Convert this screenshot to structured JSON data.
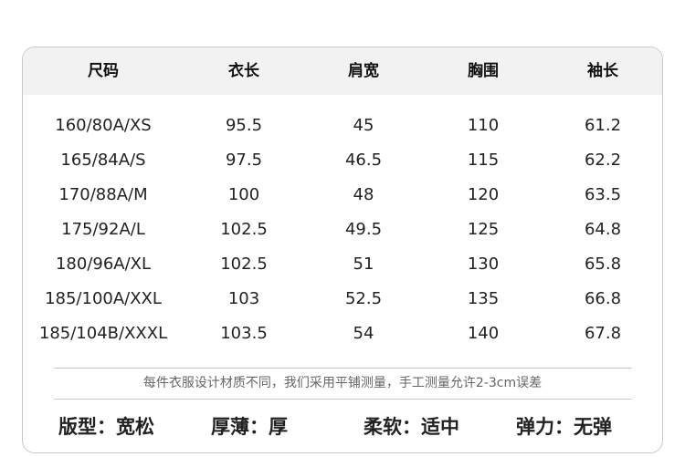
{
  "table": {
    "headers": [
      "尺码",
      "衣长",
      "肩宽",
      "胸围",
      "袖长"
    ],
    "rows": [
      [
        "160/80A/XS",
        "95.5",
        "45",
        "110",
        "61.2"
      ],
      [
        "165/84A/S",
        "97.5",
        "46.5",
        "115",
        "62.2"
      ],
      [
        "170/88A/M",
        "100",
        "48",
        "120",
        "63.5"
      ],
      [
        "175/92A/L",
        "102.5",
        "49.5",
        "125",
        "64.8"
      ],
      [
        "180/96A/XL",
        "102.5",
        "51",
        "130",
        "65.8"
      ],
      [
        "185/100A/XXL",
        "103",
        "52.5",
        "135",
        "66.8"
      ],
      [
        "185/104B/XXXL",
        "103.5",
        "54",
        "140",
        "67.8"
      ]
    ]
  },
  "note": "每件衣服设计材质不同，我们采用平铺测量，手工测量允许2-3cm误差",
  "attributes": [
    "版型：宽松",
    "厚薄：厚",
    "柔软：适中",
    "弹力：无弹"
  ],
  "colors": {
    "header_bg": "#f2f2f2",
    "border": "#c8c8c8",
    "text": "#222222",
    "note_text": "#666666"
  }
}
